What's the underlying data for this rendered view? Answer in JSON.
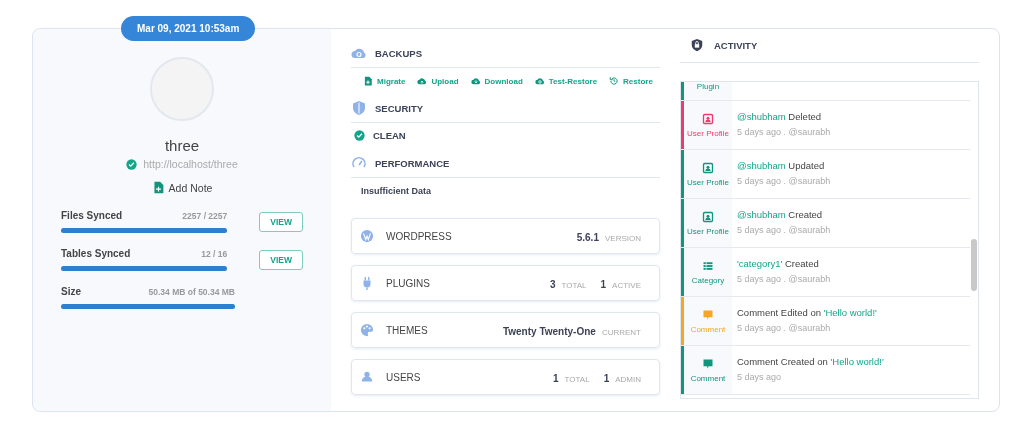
{
  "timestamp": "Mar 09, 2021 10:53am",
  "site": {
    "name": "three",
    "url": "http://localhost/three",
    "verified": true,
    "add_note": "Add Note",
    "progress": [
      {
        "label": "Files Synced",
        "reading": "2257 / 2257",
        "level": 1,
        "button": "VIEW"
      },
      {
        "label": "Tables Synced",
        "reading": "12 / 16",
        "level": 1,
        "button": "VIEW"
      },
      {
        "label": "Size",
        "reading": "50.34 MB of 50.34 MB",
        "level": 1
      }
    ]
  },
  "backups": {
    "title": "BACKUPS",
    "actions": [
      {
        "label": "Migrate",
        "kind": "file"
      },
      {
        "label": "Upload",
        "kind": "upload"
      },
      {
        "label": "Download",
        "kind": "download"
      },
      {
        "label": "Test-Restore",
        "kind": "test"
      },
      {
        "label": "Restore",
        "kind": "restore"
      }
    ]
  },
  "security": {
    "title": "SECURITY",
    "status": "CLEAN"
  },
  "performance": {
    "title": "PERFORMANCE",
    "status": "Insufficient Data"
  },
  "stats": [
    {
      "kind": "wordpress",
      "label": "WORDPRESS",
      "values": [
        {
          "value": "5.6.1",
          "unit": "VERSION"
        }
      ]
    },
    {
      "kind": "plugins",
      "label": "PLUGINS",
      "values": [
        {
          "value": "3",
          "unit": "TOTAL"
        },
        {
          "value": "1",
          "unit": "ACTIVE"
        }
      ]
    },
    {
      "kind": "themes",
      "label": "THEMES",
      "values": [
        {
          "value": "Twenty Twenty-One",
          "unit": "CURRENT"
        }
      ]
    },
    {
      "kind": "users",
      "label": "USERS",
      "values": [
        {
          "value": "1",
          "unit": "TOTAL"
        },
        {
          "value": "1",
          "unit": "ADMIN"
        }
      ]
    }
  ],
  "activity": {
    "title": "ACTIVITY",
    "items": [
      {
        "kind": "plugin",
        "category": "Plugin",
        "color": "#12957d"
      },
      {
        "kind": "user",
        "category": "User Profile",
        "color": "#ee3b6d",
        "message": [
          {
            "text": "@shubham",
            "highlight": true
          },
          {
            "text": "Deleted",
            "highlight": false
          }
        ],
        "meta": "5 days ago . @saurabh"
      },
      {
        "kind": "user",
        "category": "User Profile",
        "color": "#12957d",
        "message": [
          {
            "text": "@shubham",
            "highlight": true
          },
          {
            "text": "Updated",
            "highlight": false
          }
        ],
        "meta": "5 days ago . @saurabh"
      },
      {
        "kind": "user",
        "category": "User Profile",
        "color": "#12957d",
        "message": [
          {
            "text": "@shubham",
            "highlight": true
          },
          {
            "text": "Created",
            "highlight": false
          }
        ],
        "meta": "5 days ago . @saurabh"
      },
      {
        "kind": "category",
        "category": "Category",
        "color": "#12957d",
        "message": [
          {
            "text": "'category1'",
            "highlight": true
          },
          {
            "text": "Created",
            "highlight": false
          }
        ],
        "meta": "5 days ago . @saurabh"
      },
      {
        "kind": "comment",
        "category": "Comment",
        "color": "#f5a623",
        "message": [
          {
            "text": "Comment Edited on",
            "highlight": false
          },
          {
            "text": "'Hello world!'",
            "highlight": true
          }
        ],
        "meta": "5 days ago . @saurabh"
      },
      {
        "kind": "comment",
        "category": "Comment",
        "color": "#12957d",
        "message": [
          {
            "text": "Comment Created on",
            "highlight": false
          },
          {
            "text": "'Hello world!'",
            "highlight": true
          }
        ],
        "meta": "5 days ago"
      }
    ]
  }
}
